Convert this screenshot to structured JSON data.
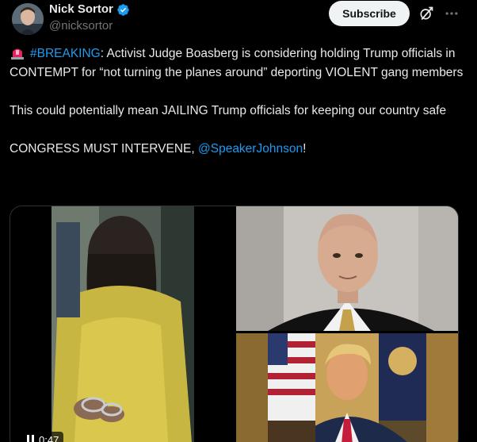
{
  "author": {
    "name": "Nick Sortor",
    "handle": "@nicksortor",
    "verified_icon": "verified-badge-icon",
    "avatar_icon": "avatar"
  },
  "actions": {
    "subscribe_label": "Subscribe",
    "grok_icon": "grok-icon",
    "more_icon": "more-options-icon"
  },
  "tweet": {
    "emoji": "rotating-light-icon",
    "hashtag": "#BREAKING",
    "line1_rest": ": Activist Judge Boasberg is considering holding Trump officials in CONTEMPT for “not turning the planes around” deporting VIOLENT gang members",
    "para2": "This could potentially mean JAILING Trump officials for keeping our country safe",
    "para3_prefix": "CONGRESS MUST INTERVENE, ",
    "mention": "@SpeakerJohnson",
    "para3_suffix": "!"
  },
  "media": {
    "video_duration": "0:47",
    "video_icon": "pause-icon"
  },
  "colors": {
    "background": "#000000",
    "text": "#e7e9ea",
    "secondary": "#71767b",
    "link": "#1d9bf0",
    "verified": "#1d9bf0",
    "subscribe_bg": "#eff3f4"
  }
}
